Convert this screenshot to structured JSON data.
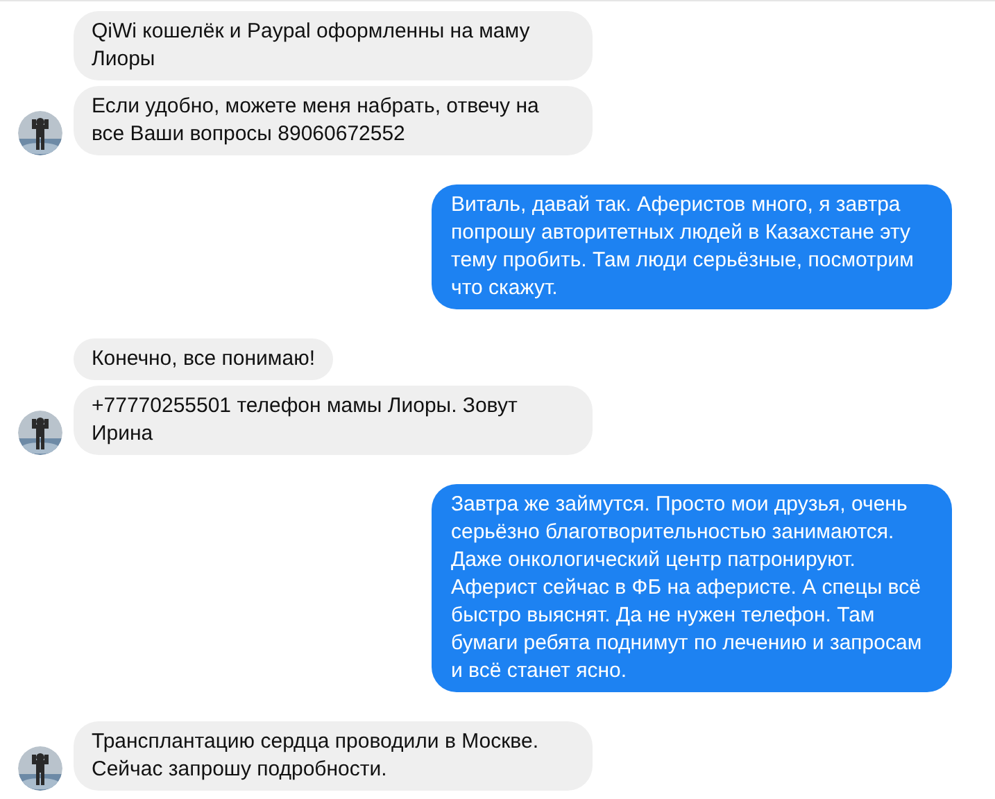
{
  "groups": [
    {
      "kind": "incoming",
      "messages": [
        "QiWi кошелёк и Paypal  оформленны на маму Лиоры",
        "Если удобно, можете меня набрать, отвечу на все Ваши вопросы 89060672552"
      ]
    },
    {
      "kind": "outgoing",
      "messages": [
        "Виталь, давай так. Аферистов много, я завтра попрошу авторитетных людей в Казахстане эту тему пробить. Там люди серьёзные, посмотрим что скажут."
      ]
    },
    {
      "kind": "incoming",
      "messages": [
        "Конечно,  все понимаю!",
        "+77770255501 телефон мамы Лиоры. Зовут Ирина"
      ]
    },
    {
      "kind": "outgoing",
      "messages": [
        "Завтра же займутся. Просто мои друзья, очень серьёзно благотворительностью занимаются. Даже онкологический центр патронируют. Аферист сейчас в ФБ на аферисте. А спецы всё быстро выяснят. Да не нужен телефон. Там бумаги ребята поднимут по лечению и запросам и всё станет ясно."
      ]
    },
    {
      "kind": "incoming",
      "messages": [
        "Трансплантацию сердца проводили в Москве. Сейчас запрошу подробности."
      ]
    }
  ]
}
